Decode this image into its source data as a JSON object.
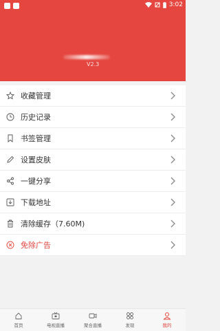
{
  "status": {
    "time": "3:02"
  },
  "header": {
    "version": "V2.3"
  },
  "menu": [
    {
      "label": "收藏管理",
      "icon": "star-icon"
    },
    {
      "label": "历史记录",
      "icon": "clock-icon"
    },
    {
      "label": "书签管理",
      "icon": "bookmark-icon"
    },
    {
      "label": "设置皮肤",
      "icon": "pencil-icon"
    },
    {
      "label": "一键分享",
      "icon": "share-icon"
    },
    {
      "label": "下载地址",
      "icon": "download-icon"
    },
    {
      "label": "清除缓存（7.60M)",
      "icon": "trash-icon"
    },
    {
      "label": "免除广告",
      "icon": "close-circle-icon"
    }
  ],
  "tabs": [
    {
      "label": "首页",
      "icon": "home-icon"
    },
    {
      "label": "电视直播",
      "icon": "tv-icon"
    },
    {
      "label": "聚合直播",
      "icon": "video-icon"
    },
    {
      "label": "发现",
      "icon": "grid-icon"
    },
    {
      "label": "我的",
      "icon": "user-icon"
    }
  ],
  "colors": {
    "accent": "#e5463f"
  }
}
